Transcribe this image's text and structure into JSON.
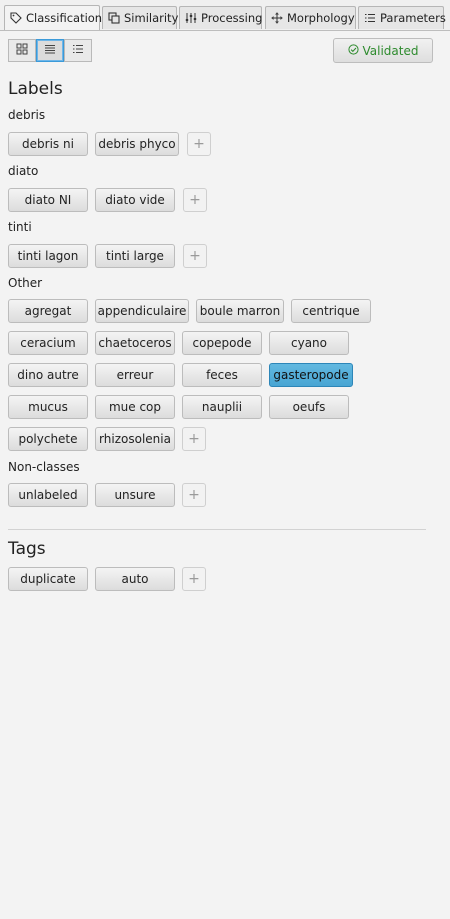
{
  "tabs": [
    {
      "label": "Classification",
      "icon": "tag-icon"
    },
    {
      "label": "Similarity",
      "icon": "copy-icon"
    },
    {
      "label": "Processing",
      "icon": "sliders-icon"
    },
    {
      "label": "Morphology",
      "icon": "move-icon"
    },
    {
      "label": "Parameters",
      "icon": "list-icon"
    }
  ],
  "toolbar": {
    "view_buttons": [
      "grid-view",
      "compact-list-view",
      "detail-list-view"
    ],
    "validated_label": "Validated",
    "validated_color": "#2e8b2e"
  },
  "labels": {
    "heading": "Labels",
    "groups": [
      {
        "name": "debris",
        "items": [
          "debris ni",
          "debris phyco"
        ]
      },
      {
        "name": "diato",
        "items": [
          "diato NI",
          "diato vide"
        ]
      },
      {
        "name": "tinti",
        "items": [
          "tinti lagon",
          "tinti large"
        ]
      },
      {
        "name": "Other",
        "items": [
          "agregat",
          "appendiculaire",
          "boule marron",
          "centrique",
          "ceracium",
          "chaetoceros",
          "copepode",
          "cyano",
          "dino autre",
          "erreur",
          "feces",
          "gasteropode",
          "mucus",
          "mue cop",
          "nauplii",
          "oeufs",
          "polychete",
          "rhizosolenia"
        ]
      },
      {
        "name": "Non-classes",
        "items": [
          "unlabeled",
          "unsure"
        ]
      }
    ],
    "selected": "gasteropode",
    "selected_color": "#4fabd8"
  },
  "tags": {
    "heading": "Tags",
    "items": [
      "duplicate",
      "auto"
    ]
  }
}
